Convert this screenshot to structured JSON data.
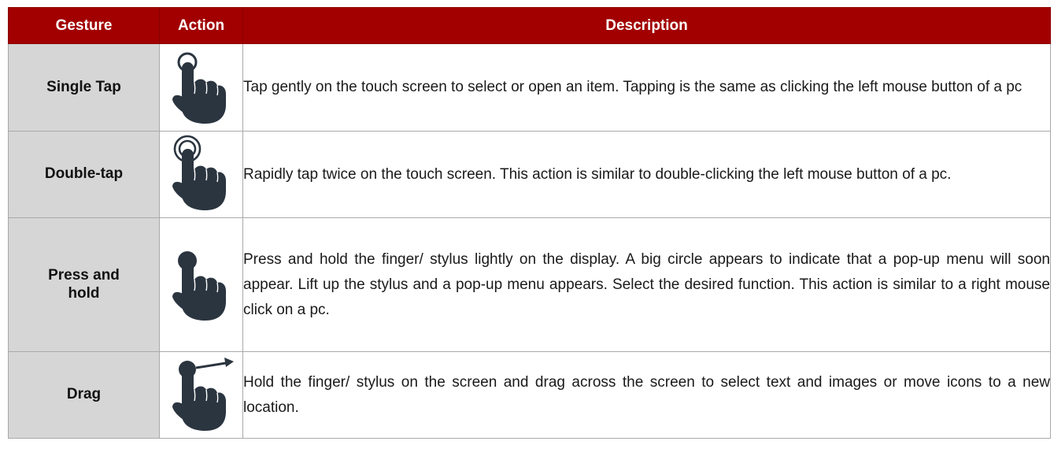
{
  "table": {
    "headers": {
      "gesture": "Gesture",
      "action": "Action",
      "description": "Description"
    },
    "rows": [
      {
        "gesture": "Single Tap",
        "action_icon": "single-tap-gesture-icon",
        "description": "Tap gently on the touch screen to select or open an item. Tapping is the same as clicking the left mouse button of a pc"
      },
      {
        "gesture": "Double-tap",
        "action_icon": "double-tap-gesture-icon",
        "description": "Rapidly tap twice on the touch screen. This action is similar to double-clicking the left mouse button of a pc."
      },
      {
        "gesture": "Press and hold",
        "action_icon": "press-and-hold-gesture-icon",
        "description": "Press and hold the finger/ stylus lightly on the display. A big circle appears to indicate that a pop-up menu will soon appear. Lift up the stylus and a pop-up menu appears. Select the desired function. This action is similar to a right mouse click on a pc."
      },
      {
        "gesture": "Drag",
        "action_icon": "drag-gesture-icon",
        "description": "Hold the finger/ stylus on the screen and drag across the screen to select text and images or move icons to a new location."
      }
    ]
  },
  "colors": {
    "header_background": "#a20000",
    "header_text": "#ffffff",
    "gesture_cell_background": "#d6d6d6",
    "icon_color": "#2b3540"
  }
}
